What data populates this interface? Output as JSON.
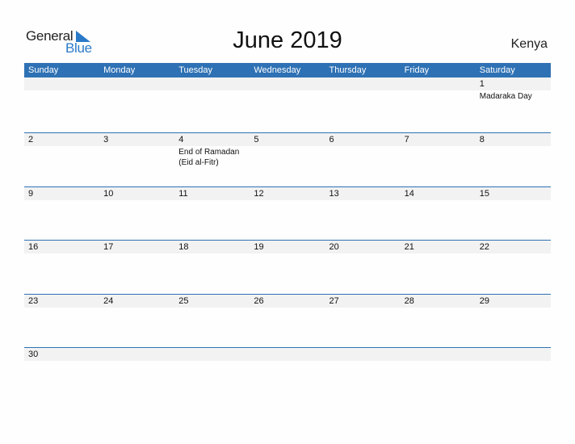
{
  "logo": {
    "line1": "General",
    "line2": "Blue"
  },
  "title": "June 2019",
  "country": "Kenya",
  "colors": {
    "header": "#2e71b4",
    "date_strip": "#f2f2f2",
    "logo_blue": "#2a7ac8"
  },
  "weekdays": [
    "Sunday",
    "Monday",
    "Tuesday",
    "Wednesday",
    "Thursday",
    "Friday",
    "Saturday"
  ],
  "weeks": [
    [
      {
        "day": "",
        "event": ""
      },
      {
        "day": "",
        "event": ""
      },
      {
        "day": "",
        "event": ""
      },
      {
        "day": "",
        "event": ""
      },
      {
        "day": "",
        "event": ""
      },
      {
        "day": "",
        "event": ""
      },
      {
        "day": "1",
        "event": "Madaraka Day"
      }
    ],
    [
      {
        "day": "2",
        "event": ""
      },
      {
        "day": "3",
        "event": ""
      },
      {
        "day": "4",
        "event": "End of Ramadan (Eid al-Fitr)"
      },
      {
        "day": "5",
        "event": ""
      },
      {
        "day": "6",
        "event": ""
      },
      {
        "day": "7",
        "event": ""
      },
      {
        "day": "8",
        "event": ""
      }
    ],
    [
      {
        "day": "9",
        "event": ""
      },
      {
        "day": "10",
        "event": ""
      },
      {
        "day": "11",
        "event": ""
      },
      {
        "day": "12",
        "event": ""
      },
      {
        "day": "13",
        "event": ""
      },
      {
        "day": "14",
        "event": ""
      },
      {
        "day": "15",
        "event": ""
      }
    ],
    [
      {
        "day": "16",
        "event": ""
      },
      {
        "day": "17",
        "event": ""
      },
      {
        "day": "18",
        "event": ""
      },
      {
        "day": "19",
        "event": ""
      },
      {
        "day": "20",
        "event": ""
      },
      {
        "day": "21",
        "event": ""
      },
      {
        "day": "22",
        "event": ""
      }
    ],
    [
      {
        "day": "23",
        "event": ""
      },
      {
        "day": "24",
        "event": ""
      },
      {
        "day": "25",
        "event": ""
      },
      {
        "day": "26",
        "event": ""
      },
      {
        "day": "27",
        "event": ""
      },
      {
        "day": "28",
        "event": ""
      },
      {
        "day": "29",
        "event": ""
      }
    ],
    [
      {
        "day": "30",
        "event": ""
      },
      {
        "day": "",
        "event": ""
      },
      {
        "day": "",
        "event": ""
      },
      {
        "day": "",
        "event": ""
      },
      {
        "day": "",
        "event": ""
      },
      {
        "day": "",
        "event": ""
      },
      {
        "day": "",
        "event": ""
      }
    ]
  ]
}
